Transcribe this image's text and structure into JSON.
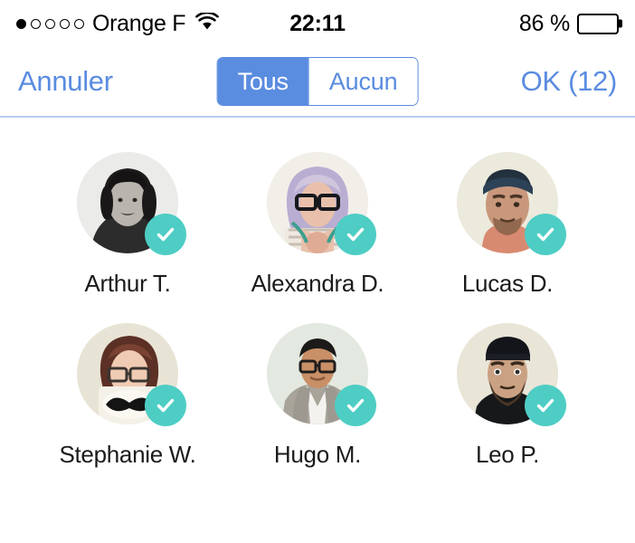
{
  "status_bar": {
    "carrier": "Orange F",
    "signal_dots_total": 5,
    "signal_dots_filled": 1,
    "wifi": "wifi-icon",
    "time": "22:11",
    "battery_percent": "86 %",
    "battery_level": 86
  },
  "nav_bar": {
    "cancel_label": "Annuler",
    "confirm_label": "OK (12)",
    "segmented": {
      "options": [
        "Tous",
        "Aucun"
      ],
      "selected": "Tous"
    },
    "accent_color": "#5a8ce0",
    "separator_color": "#b9cbee"
  },
  "contacts": {
    "check_color": "#4ecdc4",
    "items": [
      {
        "name": "Arthur T.",
        "selected": true,
        "avatar": "man-long-hair-black-white"
      },
      {
        "name": "Alexandra D.",
        "selected": true,
        "avatar": "woman-lavender-hair-glasses"
      },
      {
        "name": "Lucas D.",
        "selected": true,
        "avatar": "man-headband-beard"
      },
      {
        "name": "Stephanie W.",
        "selected": true,
        "avatar": "woman-glasses-mustache-mug"
      },
      {
        "name": "Hugo M.",
        "selected": true,
        "avatar": "man-glasses-grey-blazer"
      },
      {
        "name": "Leo P.",
        "selected": true,
        "avatar": "man-beanie-beard"
      }
    ]
  }
}
